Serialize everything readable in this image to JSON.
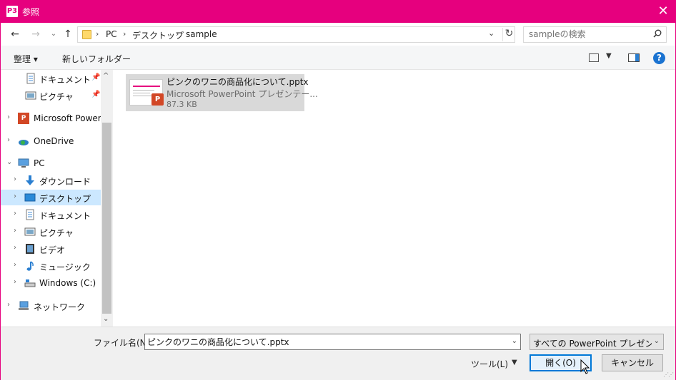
{
  "titlebar": {
    "app_icon": "P3",
    "title": "参照",
    "close": "✕"
  },
  "nav": {
    "back": "←",
    "forward": "→",
    "recent": "⌄",
    "up": "↑",
    "breadcrumb": [
      "PC",
      "デスクトップ",
      "sample"
    ],
    "search_placeholder": "sampleの検索"
  },
  "cmdbar": {
    "organize": "整理 ▾",
    "new_folder": "新しいフォルダー",
    "help": "?"
  },
  "tree": [
    {
      "label": "ドキュメント",
      "icon": "document-icon",
      "pinned": true
    },
    {
      "label": "ピクチャ",
      "icon": "picture-icon",
      "pinned": true
    },
    {
      "label": "Microsoft PowerP",
      "icon": "powerpoint-icon"
    },
    {
      "label": "OneDrive",
      "icon": "onedrive-icon"
    },
    {
      "label": "PC",
      "icon": "pc-icon",
      "expanded": true
    },
    {
      "label": "ダウンロード",
      "icon": "download-icon"
    },
    {
      "label": "デスクトップ",
      "icon": "desktop-icon",
      "selected": true
    },
    {
      "label": "ドキュメント",
      "icon": "document-icon"
    },
    {
      "label": "ピクチャ",
      "icon": "picture-icon"
    },
    {
      "label": "ビデオ",
      "icon": "video-icon"
    },
    {
      "label": "ミュージック",
      "icon": "music-icon"
    },
    {
      "label": "Windows (C:)",
      "icon": "drive-icon"
    },
    {
      "label": "ネットワーク",
      "icon": "network-icon"
    }
  ],
  "file": {
    "name": "ピンクのワニの商品化について.pptx",
    "type": "Microsoft PowerPoint プレゼンテー...",
    "size": "87.3 KB",
    "badge": "P"
  },
  "footer": {
    "filename_label": "ファイル名(N):",
    "filename_value": "ピンクのワニの商品化について.pptx",
    "filetype": "すべての PowerPoint プレゼンテーシ",
    "tools": "ツール(L)",
    "open": "開く(O)",
    "cancel": "キャンセル"
  },
  "colors": {
    "accent": "#e6007e",
    "selection": "#cce8ff",
    "primary_border": "#0078d7"
  }
}
